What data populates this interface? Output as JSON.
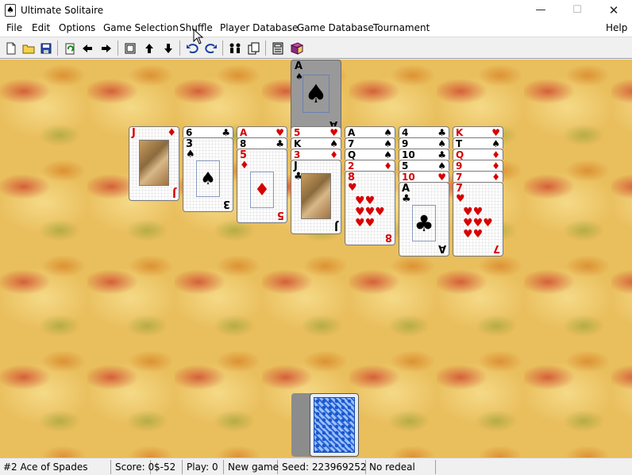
{
  "window": {
    "title": "Ultimate Solitaire",
    "app_icon": "♠",
    "minimize": "—",
    "maximize": "☐",
    "close": "✕"
  },
  "menu": {
    "items": [
      "File",
      "Edit",
      "Options",
      "Game Selection",
      "Shuffle",
      "Player Database",
      "Game Database",
      "Tournament"
    ],
    "help": "Help"
  },
  "toolbar": {
    "buttons": [
      "new-icon",
      "open-icon",
      "save-icon",
      "redeal-icon",
      "back-icon",
      "forward-icon",
      "deck-icon",
      "up-icon",
      "down-icon",
      "undo-icon",
      "redo-icon",
      "players-icon",
      "tournament-icon",
      "calculator-icon",
      "book-icon"
    ]
  },
  "foundation": {
    "rank": "A",
    "suit": "♠",
    "color": "#000000"
  },
  "tableau": [
    {
      "cards": [
        {
          "rank": "J",
          "suit": "♦",
          "color": "red"
        }
      ]
    },
    {
      "cards": [
        {
          "rank": "6",
          "suit": "♣",
          "color": "black"
        },
        {
          "rank": "3",
          "suit": "♠",
          "color": "black"
        }
      ]
    },
    {
      "cards": [
        {
          "rank": "A",
          "suit": "♥",
          "color": "red"
        },
        {
          "rank": "8",
          "suit": "♣",
          "color": "black"
        },
        {
          "rank": "5",
          "suit": "♦",
          "color": "red"
        }
      ]
    },
    {
      "cards": [
        {
          "rank": "5",
          "suit": "♥",
          "color": "red"
        },
        {
          "rank": "K",
          "suit": "♠",
          "color": "black"
        },
        {
          "rank": "3",
          "suit": "♦",
          "color": "red"
        },
        {
          "rank": "J",
          "suit": "♣",
          "color": "black"
        }
      ]
    },
    {
      "cards": [
        {
          "rank": "A",
          "suit": "♠",
          "color": "black"
        },
        {
          "rank": "7",
          "suit": "♠",
          "color": "black"
        },
        {
          "rank": "Q",
          "suit": "♠",
          "color": "black"
        },
        {
          "rank": "2",
          "suit": "♦",
          "color": "red"
        },
        {
          "rank": "8",
          "suit": "♥",
          "color": "red"
        }
      ]
    },
    {
      "cards": [
        {
          "rank": "4",
          "suit": "♣",
          "color": "black"
        },
        {
          "rank": "9",
          "suit": "♠",
          "color": "black"
        },
        {
          "rank": "10",
          "suit": "♣",
          "color": "black"
        },
        {
          "rank": "5",
          "suit": "♠",
          "color": "black"
        },
        {
          "rank": "10",
          "suit": "♥",
          "color": "red"
        },
        {
          "rank": "A",
          "suit": "♣",
          "color": "black"
        }
      ]
    },
    {
      "cards": [
        {
          "rank": "K",
          "suit": "♥",
          "color": "red"
        },
        {
          "rank": "T",
          "suit": "♠",
          "color": "black"
        },
        {
          "rank": "Q",
          "suit": "♦",
          "color": "red"
        },
        {
          "rank": "9",
          "suit": "♦",
          "color": "red"
        },
        {
          "rank": "7",
          "suit": "♦",
          "color": "red"
        },
        {
          "rank": "7",
          "suit": "♥",
          "color": "red"
        }
      ]
    }
  ],
  "status": {
    "card": "#2 Ace of Spades",
    "score": "Score: 0",
    "money": "$-52",
    "play": "Play: 0",
    "state": "New game",
    "seed": "Seed: 223969252",
    "redeal": "No redeal"
  },
  "colors": {
    "red": "#d60000",
    "black": "#000000",
    "felt": "#e9be5c",
    "card_back": "#1b58c8"
  }
}
